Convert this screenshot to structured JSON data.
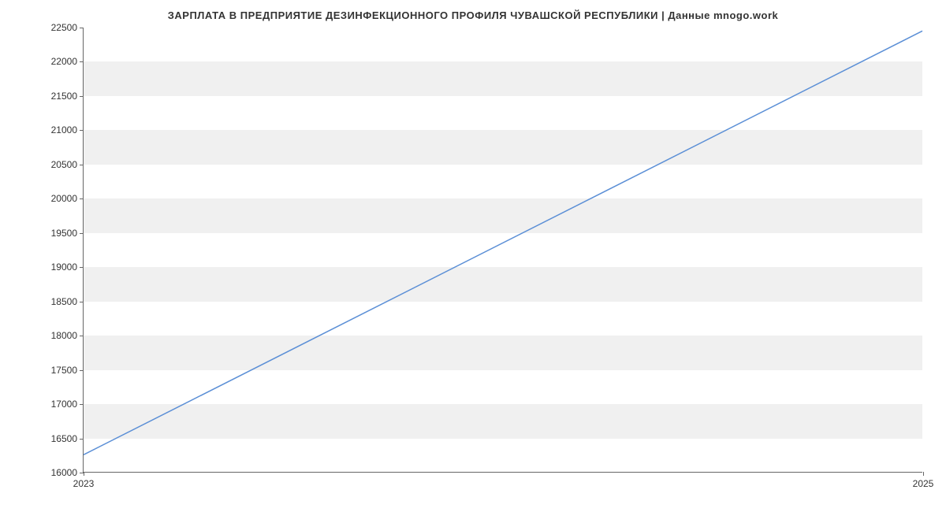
{
  "chart_data": {
    "type": "line",
    "title": "ЗАРПЛАТА В  ПРЕДПРИЯТИЕ ДЕЗИНФЕКЦИОННОГО ПРОФИЛЯ ЧУВАШСКОЙ РЕСПУБЛИКИ | Данные mnogo.work",
    "xlabel": "",
    "ylabel": "",
    "x": [
      2023,
      2025
    ],
    "values": [
      16250,
      22450
    ],
    "x_ticks": [
      2023,
      2025
    ],
    "y_ticks": [
      16000,
      16500,
      17000,
      17500,
      18000,
      18500,
      19000,
      19500,
      20000,
      20500,
      21000,
      21500,
      22000,
      22500
    ],
    "xlim": [
      2023,
      2025
    ],
    "ylim": [
      16000,
      22500
    ],
    "line_color": "#5b8fd6"
  }
}
